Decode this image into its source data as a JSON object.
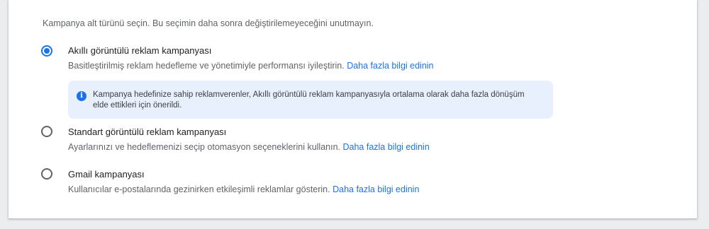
{
  "intro_text": "Kampanya alt türünü seçin. Bu seçimin daha sonra değiştirilemeyeceğini unutmayın.",
  "options": [
    {
      "title": "Akıllı görüntülü reklam kampanyası",
      "description": "Basitleştirilmiş reklam hedefleme ve yönetimiyle performansı iyileştirin.",
      "link": "Daha fazla bilgi edinin",
      "selected": true
    },
    {
      "title": "Standart görüntülü reklam kampanyası",
      "description": "Ayarlarınızı ve hedeflemenizi seçip otomasyon seçeneklerini kullanın.",
      "link": "Daha fazla bilgi edinin",
      "selected": false
    },
    {
      "title": "Gmail kampanyası",
      "description": "Kullanıcılar e-postalarında gezinirken etkileşimli reklamlar gösterin.",
      "link": "Daha fazla bilgi edinin",
      "selected": false
    }
  ],
  "info_box": {
    "icon": "info-icon",
    "icon_glyph": "i",
    "text": "Kampanya hedefinize sahip reklamverenler, Akıllı görüntülü reklam kampanyasıyla ortalama olarak daha fazla dönüşüm elde ettikleri için önerildi."
  },
  "colors": {
    "accent": "#1a73e8",
    "info_background": "#e8f0fe",
    "text_primary": "#202124",
    "text_secondary": "#5f6368"
  }
}
